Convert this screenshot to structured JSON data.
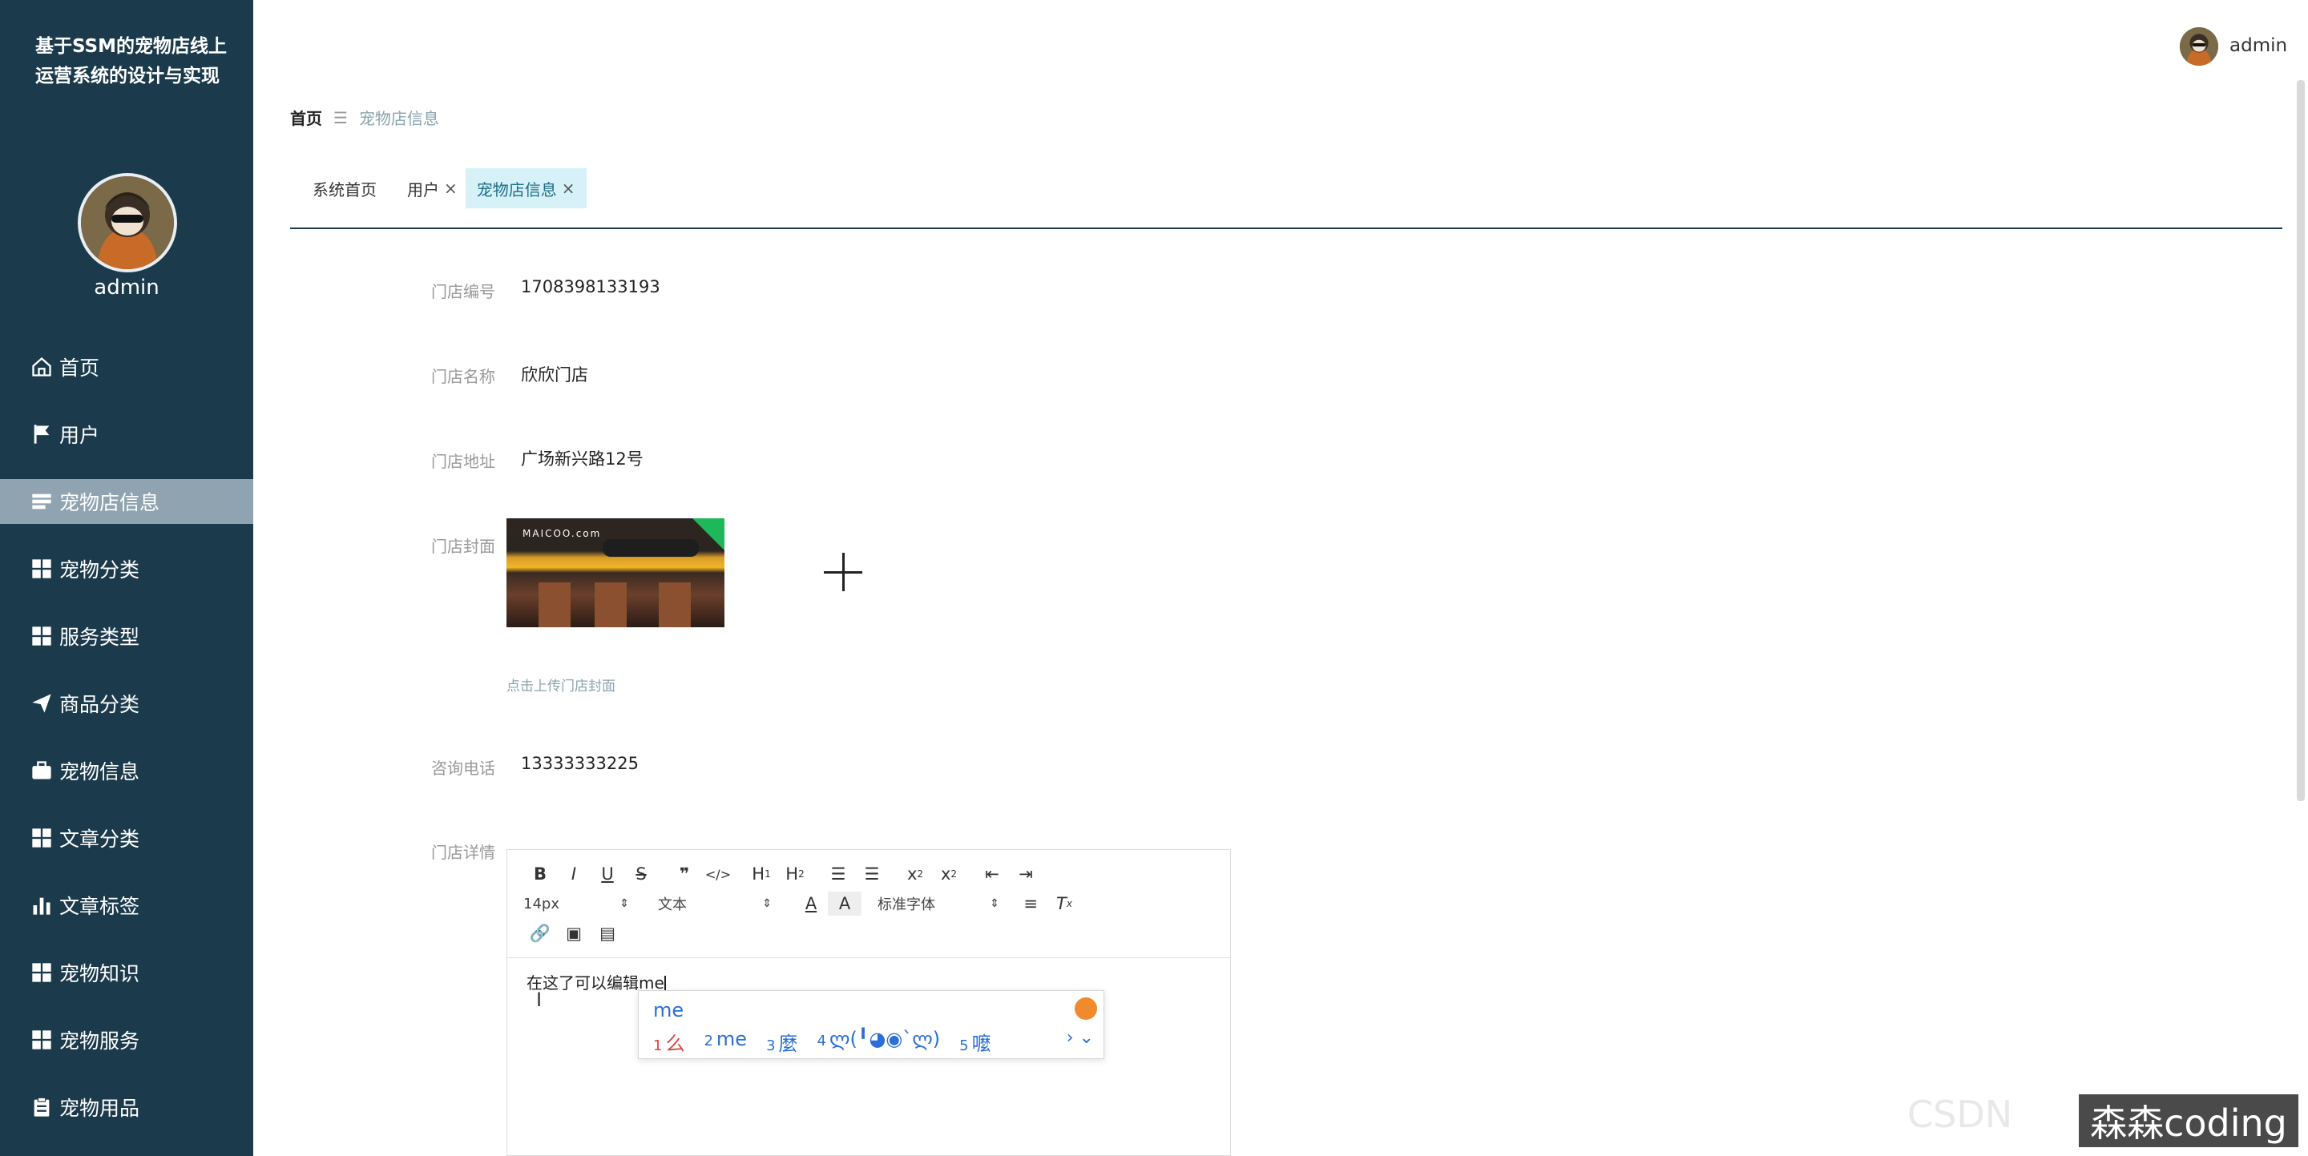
{
  "app": {
    "title": "基于SSM的宠物店线上运营系统的设计与实现",
    "user": "admin"
  },
  "sidebar": {
    "items": [
      {
        "label": "首页",
        "icon": "home-icon"
      },
      {
        "label": "用户",
        "icon": "flag-icon"
      },
      {
        "label": "宠物店信息",
        "icon": "list-icon",
        "active": true
      },
      {
        "label": "宠物分类",
        "icon": "grid-icon"
      },
      {
        "label": "服务类型",
        "icon": "grid-icon"
      },
      {
        "label": "商品分类",
        "icon": "paper-plane-icon"
      },
      {
        "label": "宠物信息",
        "icon": "briefcase-icon"
      },
      {
        "label": "文章分类",
        "icon": "grid-icon"
      },
      {
        "label": "文章标签",
        "icon": "bar-chart-icon"
      },
      {
        "label": "宠物知识",
        "icon": "grid-icon"
      },
      {
        "label": "宠物服务",
        "icon": "grid-icon"
      },
      {
        "label": "宠物用品",
        "icon": "clipboard-icon"
      }
    ]
  },
  "breadcrumb": {
    "home": "首页",
    "current": "宠物店信息"
  },
  "tabs": [
    {
      "label": "系统首页",
      "closable": false
    },
    {
      "label": "用户",
      "closable": true
    },
    {
      "label": "宠物店信息",
      "closable": true,
      "active": true
    }
  ],
  "form": {
    "store_no_label": "门店编号",
    "store_no": "1708398133193",
    "store_name_label": "门店名称",
    "store_name": "欣欣门店",
    "store_address_label": "门店地址",
    "store_address": "广场新兴路12号",
    "cover_label": "门店封面",
    "cover_img_text": "MAICOO.com",
    "cover_upload_tip": "点击上传门店封面",
    "phone_label": "咨询电话",
    "phone": "13333333225",
    "detail_label": "门店详情"
  },
  "editor": {
    "font_size": "14px",
    "block_type": "文本",
    "font_family": "标准字体",
    "content": "在这了可以编辑me"
  },
  "ime": {
    "input": "me",
    "candidates": [
      {
        "num": "1",
        "text": "么"
      },
      {
        "num": "2",
        "text": "me"
      },
      {
        "num": "3",
        "text": "麼"
      },
      {
        "num": "4",
        "text": "ლ(╹◕◉`ლ)"
      },
      {
        "num": "5",
        "text": "嚒"
      }
    ],
    "nav": "› ⌄"
  },
  "watermark": {
    "text": "森森coding",
    "faint": "CSDN"
  },
  "colors": {
    "sidebar_bg": "#1b3a4b",
    "sidebar_active": "#8fa4b0",
    "tab_active_bg": "#d6f2f8"
  }
}
